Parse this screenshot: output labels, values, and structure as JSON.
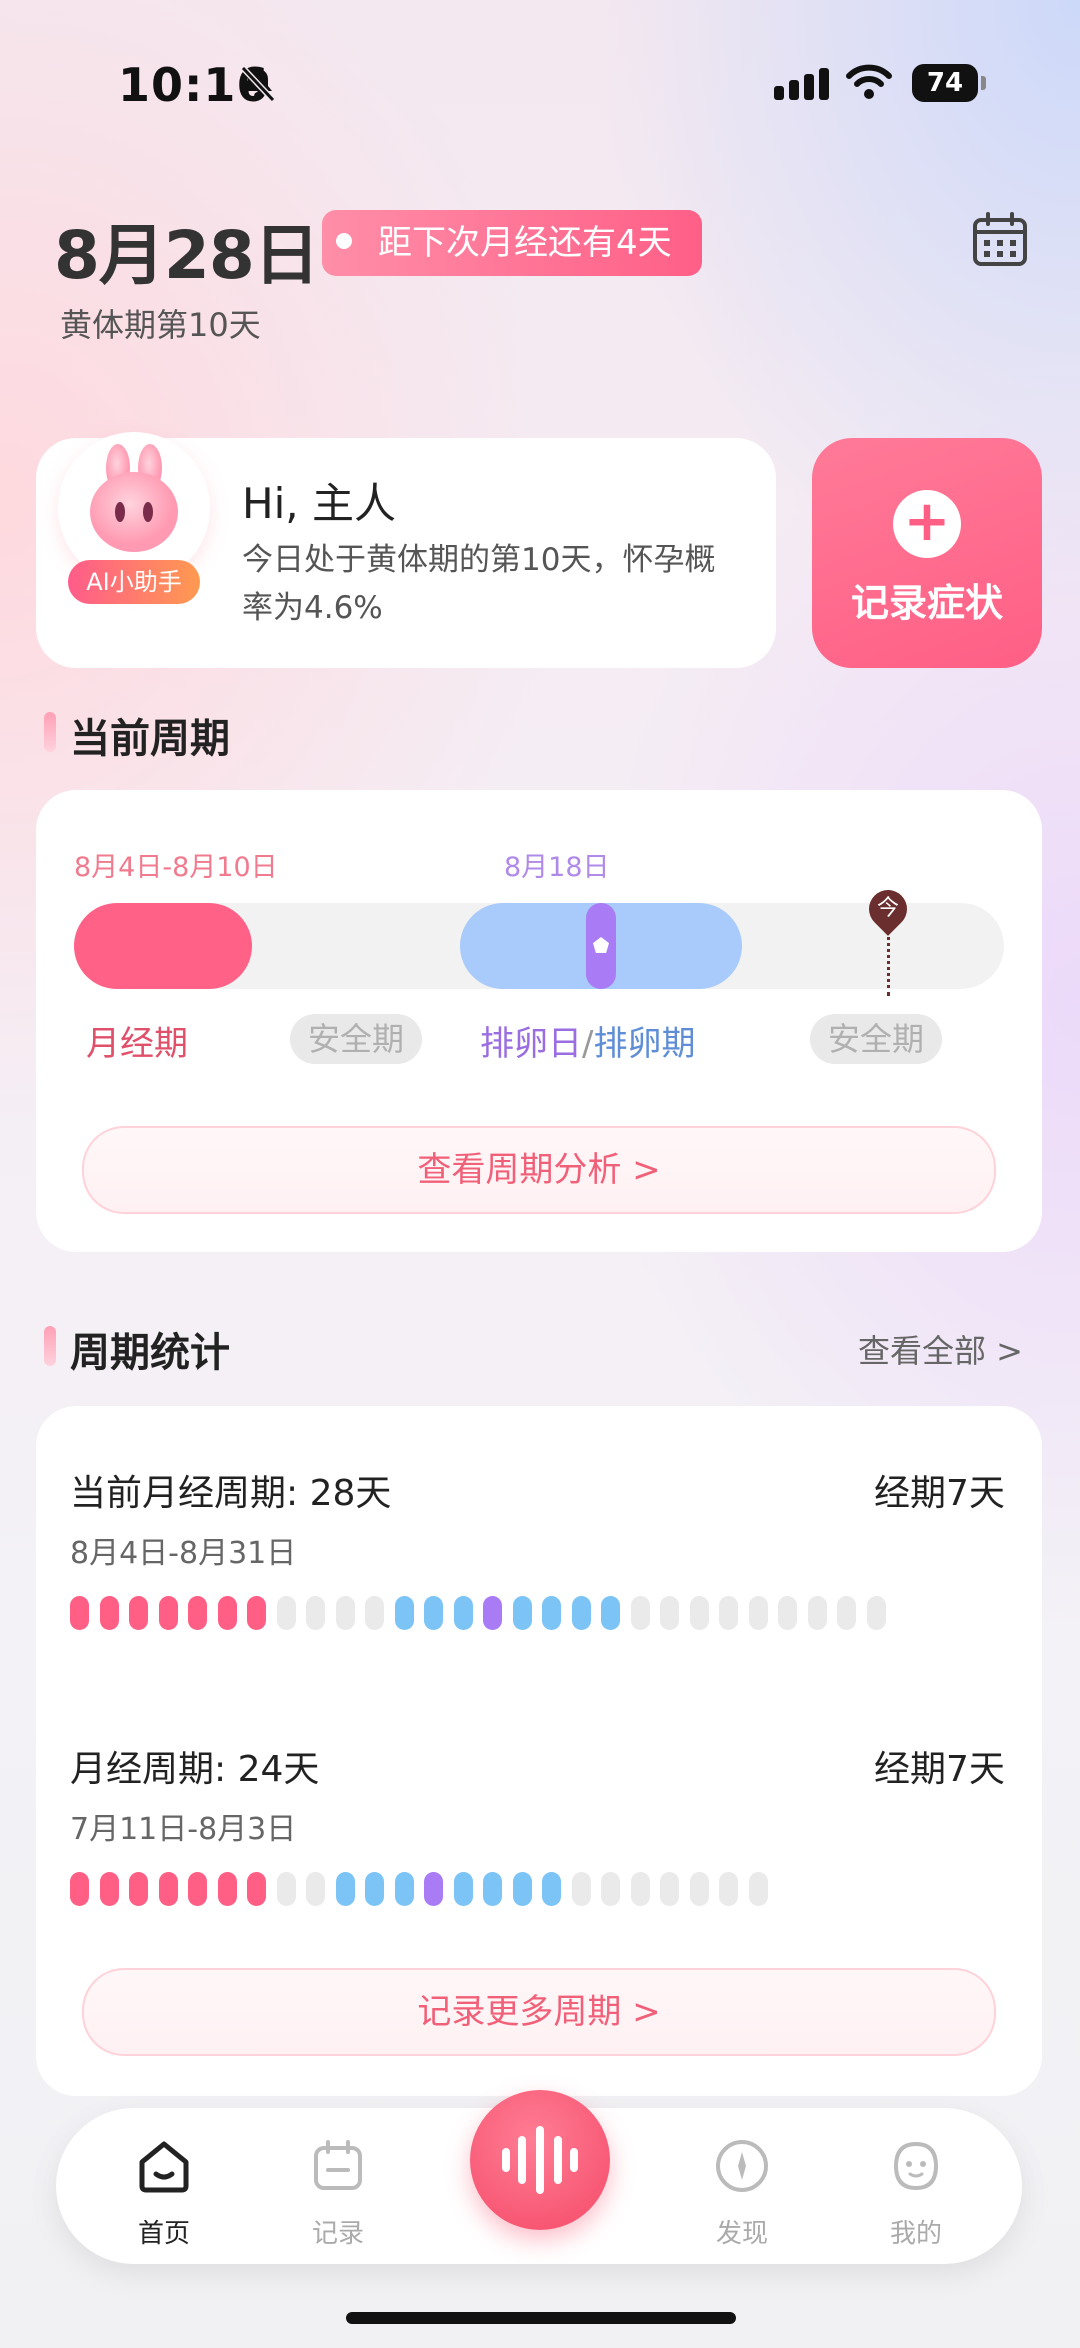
{
  "status_bar": {
    "time": "10:16",
    "battery": "74"
  },
  "header": {
    "date": "8月28日",
    "countdown_tag": "距下次月经还有4天",
    "phase": "黄体期第10天"
  },
  "ai_card": {
    "badge": "AI小助手",
    "greeting": "Hi, 主人",
    "message": "今日处于黄体期的第10天，怀孕概率为4.6%"
  },
  "record_button": {
    "label": "记录症状"
  },
  "current_cycle": {
    "title": "当前周期",
    "period_range": "8月4日-8月10日",
    "ovulation_date": "8月18日",
    "today_marker": "今",
    "labels": {
      "period": "月经期",
      "safe1": "安全期",
      "ovulation_day": "排卵日",
      "slash": "/",
      "ovulation_phase": "排卵期",
      "safe2": "安全期"
    },
    "analysis_button": "查看周期分析 >"
  },
  "cycle_stats": {
    "title": "周期统计",
    "view_all": "查看全部 >",
    "rows": [
      {
        "title": "当前月经周期: 28天",
        "period": "经期7天",
        "range": "8月4日-8月31日",
        "days": [
          "p",
          "p",
          "p",
          "p",
          "p",
          "p",
          "p",
          "g",
          "g",
          "g",
          "g",
          "b",
          "b",
          "b",
          "v",
          "b",
          "b",
          "b",
          "b",
          "g",
          "g",
          "g",
          "g",
          "g",
          "g",
          "g",
          "g",
          "g"
        ]
      },
      {
        "title": "月经周期: 24天",
        "period": "经期7天",
        "range": "7月11日-8月3日",
        "days": [
          "p",
          "p",
          "p",
          "p",
          "p",
          "p",
          "p",
          "g",
          "g",
          "b",
          "b",
          "b",
          "v",
          "b",
          "b",
          "b",
          "b",
          "g",
          "g",
          "g",
          "g",
          "g",
          "g",
          "g"
        ]
      }
    ],
    "more_button": "记录更多周期 >"
  },
  "colors": {
    "period": "#ff5f85",
    "ovulation": "#7cc4f5",
    "ovulation_day": "#a97cf6",
    "safe": "#eaeaea"
  },
  "bottom_nav": {
    "items": [
      {
        "label": "首页",
        "icon": "home-icon"
      },
      {
        "label": "记录",
        "icon": "calendar-record-icon"
      },
      {
        "label": "",
        "icon": "voice-icon"
      },
      {
        "label": "发现",
        "icon": "compass-icon"
      },
      {
        "label": "我的",
        "icon": "profile-icon"
      }
    ]
  }
}
